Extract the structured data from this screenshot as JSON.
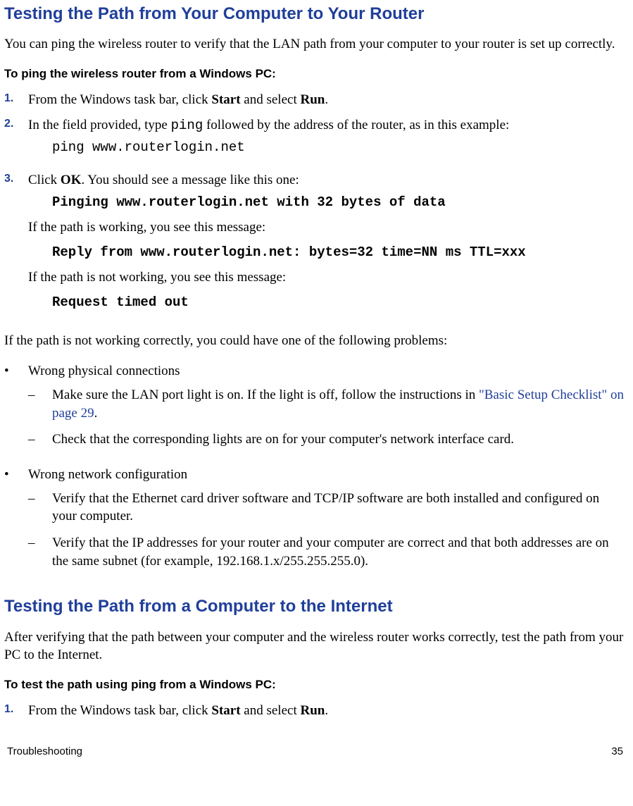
{
  "section1": {
    "heading": "Testing the Path from Your Computer to Your Router",
    "intro": "You can ping the wireless router to verify that the LAN path from your computer to your router is set up correctly.",
    "subhead": "To ping the wireless router from a Windows PC:",
    "steps": {
      "n1": "1.",
      "s1a": "From the Windows task bar, click ",
      "s1b": "Start",
      "s1c": " and select ",
      "s1d": "Run",
      "s1e": ".",
      "n2": "2.",
      "s2a": "In the field provided, type ",
      "s2b": "ping",
      "s2c": " followed by the address of the router, as in this example:",
      "s2code": "ping www.routerlogin.net",
      "n3": "3.",
      "s3a": "Click ",
      "s3b": "OK",
      "s3c": ". You should see a message like this one:",
      "s3code1": "Pinging www.routerlogin.net with 32 bytes of data",
      "s3f1": "If the path is working, you see this message:",
      "s3code2": "Reply from www.routerlogin.net: bytes=32 time=NN ms TTL=xxx",
      "s3f2": "If the path is not working, you see this message:",
      "s3code3": "Request timed out"
    },
    "after": "If the path is not working correctly, you could have one of the following problems:",
    "bullets": {
      "b1": "Wrong physical connections",
      "b1d1a": "Make sure the LAN port light is on. If the light is off, follow the instructions in ",
      "b1d1link": "\"Basic Setup Checklist\" on page 29",
      "b1d1b": ".",
      "b1d2": "Check that the corresponding lights are on for your computer's network interface card.",
      "b2": "Wrong network configuration",
      "b2d1": "Verify that the Ethernet card driver software and TCP/IP software are both installed and configured on your computer.",
      "b2d2": "Verify that the IP addresses for your router and your computer are correct and that both addresses are on the same subnet (for example, 192.168.1.x/255.255.255.0)."
    }
  },
  "section2": {
    "heading": "Testing the Path from a Computer to the Internet",
    "intro": "After verifying that the path between your computer and the wireless router works correctly, test the path from your PC to the Internet.",
    "subhead": "To test the path using ping from a Windows PC:",
    "steps": {
      "n1": "1.",
      "s1a": "From the Windows task bar, click ",
      "s1b": "Start",
      "s1c": " and select ",
      "s1d": "Run",
      "s1e": "."
    }
  },
  "markers": {
    "bullet": "•",
    "dash": "–"
  },
  "footer": {
    "left": "Troubleshooting",
    "right": "35"
  }
}
